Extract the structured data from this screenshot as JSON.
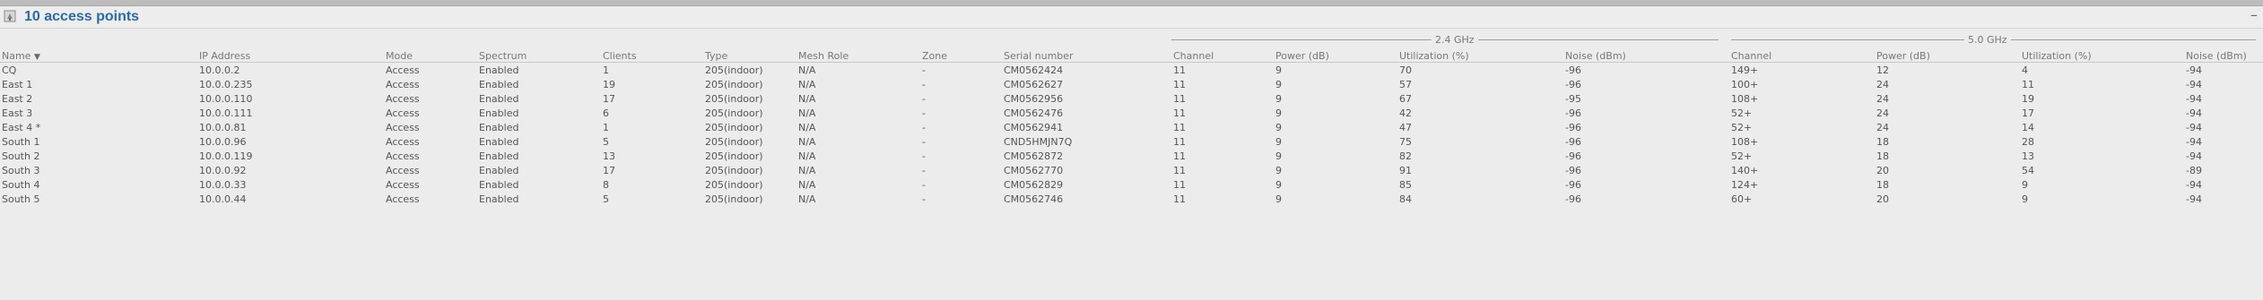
{
  "header": {
    "title": "10 access points",
    "minimize_label": "–"
  },
  "bands": {
    "band_24": "2.4 GHz",
    "band_50": "5.0 GHz"
  },
  "columns": {
    "name": "Name",
    "ip": "IP Address",
    "mode": "Mode",
    "spectrum": "Spectrum",
    "clients": "Clients",
    "type": "Type",
    "mesh": "Mesh Role",
    "zone": "Zone",
    "serial": "Serial number",
    "channel_24": "Channel",
    "power_24": "Power (dB)",
    "util_24": "Utilization (%)",
    "noise_24": "Noise (dBm)",
    "channel_50": "Channel",
    "power_50": "Power (dB)",
    "util_50": "Utilization (%)",
    "noise_50": "Noise (dBm)"
  },
  "colors": {
    "link": "#2d6bb0",
    "good": "#2e7d32",
    "warn": "#e8882a",
    "bad": "#c0181e",
    "title": "#2b6aa8"
  },
  "rows": [
    {
      "name": "CQ",
      "link": true,
      "ip": "10.0.0.2",
      "mode": "Access",
      "spectrum": "Enabled",
      "clients": "1",
      "type": "205(indoor)",
      "mesh": "N/A",
      "zone": "-",
      "serial": "CM0562424",
      "ch24": "11",
      "pw24": "9",
      "ut24": "70",
      "ut24_level": "warn",
      "nz24": "-96",
      "ch50": "149+",
      "pw50": "12",
      "ut50": "4",
      "ut50_level": "good",
      "nz50": "-94"
    },
    {
      "name": "East 1",
      "link": true,
      "ip": "10.0.0.235",
      "mode": "Access",
      "spectrum": "Enabled",
      "clients": "19",
      "type": "205(indoor)",
      "mesh": "N/A",
      "zone": "-",
      "serial": "CM0562627",
      "ch24": "11",
      "pw24": "9",
      "ut24": "57",
      "ut24_level": "warn",
      "nz24": "-96",
      "ch50": "100+",
      "pw50": "24",
      "ut50": "11",
      "ut50_level": "good",
      "nz50": "-94"
    },
    {
      "name": "East 2",
      "link": true,
      "ip": "10.0.0.110",
      "mode": "Access",
      "spectrum": "Enabled",
      "clients": "17",
      "type": "205(indoor)",
      "mesh": "N/A",
      "zone": "-",
      "serial": "CM0562956",
      "ch24": "11",
      "pw24": "9",
      "ut24": "67",
      "ut24_level": "warn",
      "nz24": "-95",
      "ch50": "108+",
      "pw50": "24",
      "ut50": "19",
      "ut50_level": "good",
      "nz50": "-94"
    },
    {
      "name": "East 3",
      "link": true,
      "ip": "10.0.0.111",
      "mode": "Access",
      "spectrum": "Enabled",
      "clients": "6",
      "type": "205(indoor)",
      "mesh": "N/A",
      "zone": "-",
      "serial": "CM0562476",
      "ch24": "11",
      "pw24": "9",
      "ut24": "42",
      "ut24_level": "good",
      "nz24": "-96",
      "ch50": "52+",
      "pw50": "24",
      "ut50": "17",
      "ut50_level": "good",
      "nz50": "-94"
    },
    {
      "name": "East 4 *",
      "link": false,
      "ip": "10.0.0.81",
      "mode": "Access",
      "spectrum": "Enabled",
      "clients": "1",
      "type": "205(indoor)",
      "mesh": "N/A",
      "zone": "-",
      "serial": "CM0562941",
      "ch24": "11",
      "pw24": "9",
      "ut24": "47",
      "ut24_level": "good",
      "nz24": "-96",
      "ch50": "52+",
      "pw50": "24",
      "ut50": "14",
      "ut50_level": "good",
      "nz50": "-94"
    },
    {
      "name": "South 1",
      "link": true,
      "ip": "10.0.0.96",
      "mode": "Access",
      "spectrum": "Enabled",
      "clients": "5",
      "type": "205(indoor)",
      "mesh": "N/A",
      "zone": "-",
      "serial": "CND5HMJN7Q",
      "ch24": "11",
      "pw24": "9",
      "ut24": "75",
      "ut24_level": "bad",
      "nz24": "-96",
      "ch50": "108+",
      "pw50": "18",
      "ut50": "28",
      "ut50_level": "good",
      "nz50": "-94"
    },
    {
      "name": "South 2",
      "link": true,
      "ip": "10.0.0.119",
      "mode": "Access",
      "spectrum": "Enabled",
      "clients": "13",
      "type": "205(indoor)",
      "mesh": "N/A",
      "zone": "-",
      "serial": "CM0562872",
      "ch24": "11",
      "pw24": "9",
      "ut24": "82",
      "ut24_level": "bad",
      "nz24": "-96",
      "ch50": "52+",
      "pw50": "18",
      "ut50": "13",
      "ut50_level": "good",
      "nz50": "-94"
    },
    {
      "name": "South 3",
      "link": true,
      "ip": "10.0.0.92",
      "mode": "Access",
      "spectrum": "Enabled",
      "clients": "17",
      "type": "205(indoor)",
      "mesh": "N/A",
      "zone": "-",
      "serial": "CM0562770",
      "ch24": "11",
      "pw24": "9",
      "ut24": "91",
      "ut24_level": "bad",
      "nz24": "-96",
      "ch50": "140+",
      "pw50": "20",
      "ut50": "54",
      "ut50_level": "warn",
      "nz50": "-89"
    },
    {
      "name": "South 4",
      "link": true,
      "ip": "10.0.0.33",
      "mode": "Access",
      "spectrum": "Enabled",
      "clients": "8",
      "type": "205(indoor)",
      "mesh": "N/A",
      "zone": "-",
      "serial": "CM0562829",
      "ch24": "11",
      "pw24": "9",
      "ut24": "85",
      "ut24_level": "bad",
      "nz24": "-96",
      "ch50": "124+",
      "pw50": "18",
      "ut50": "9",
      "ut50_level": "good",
      "nz50": "-94"
    },
    {
      "name": "South 5",
      "link": true,
      "ip": "10.0.0.44",
      "mode": "Access",
      "spectrum": "Enabled",
      "clients": "5",
      "type": "205(indoor)",
      "mesh": "N/A",
      "zone": "-",
      "serial": "CM0562746",
      "ch24": "11",
      "pw24": "9",
      "ut24": "84",
      "ut24_level": "bad",
      "nz24": "-96",
      "ch50": "60+",
      "pw50": "20",
      "ut50": "9",
      "ut50_level": "good",
      "nz50": "-94"
    }
  ]
}
